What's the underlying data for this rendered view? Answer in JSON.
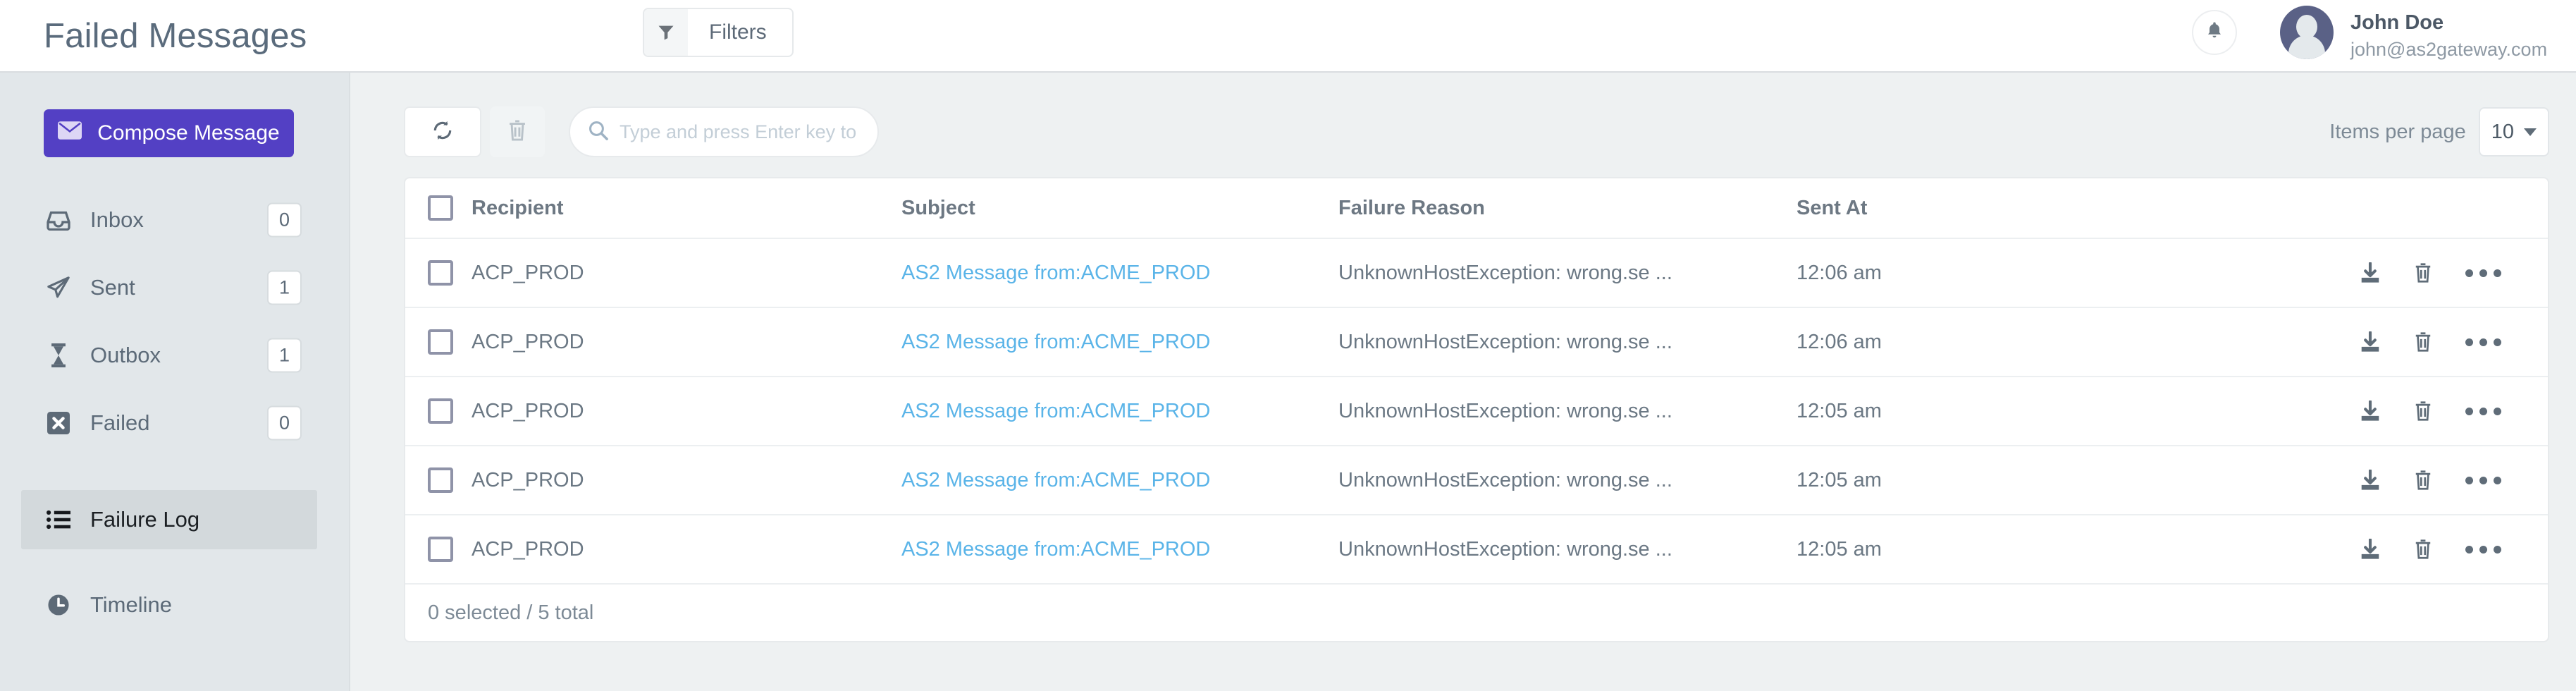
{
  "header": {
    "title": "Failed Messages",
    "filters_label": "Filters",
    "filter_icon": "funnel-icon",
    "bell_icon": "bell-icon",
    "user": {
      "name": "John Doe",
      "email": "john@as2gateway.com"
    }
  },
  "sidebar": {
    "compose_label": "Compose Message",
    "compose_icon": "envelope-icon",
    "items": [
      {
        "label": "Inbox",
        "icon": "inbox-icon",
        "badge": "0",
        "active": false
      },
      {
        "label": "Sent",
        "icon": "paper-plane-icon",
        "badge": "1",
        "active": false
      },
      {
        "label": "Outbox",
        "icon": "hourglass-icon",
        "badge": "1",
        "active": false
      },
      {
        "label": "Failed",
        "icon": "x-square-icon",
        "badge": "0",
        "active": false
      },
      {
        "label": "Failure Log",
        "icon": "list-icon",
        "badge": "",
        "active": true
      },
      {
        "label": "Timeline",
        "icon": "clock-icon",
        "badge": "",
        "active": false
      }
    ]
  },
  "toolbar": {
    "refresh_icon": "refresh-icon",
    "delete_icon": "trash-icon",
    "search_placeholder": "Type and press Enter key to search",
    "search_value": "",
    "search_icon": "search-icon",
    "items_per_page_label": "Items per page",
    "items_per_page_value": "10"
  },
  "table": {
    "columns": [
      "Recipient",
      "Subject",
      "Failure Reason",
      "Sent At"
    ],
    "rows": [
      {
        "recipient": "ACP_PROD",
        "subject": "AS2 Message from:ACME_PROD",
        "reason": "UnknownHostException: wrong.se ...",
        "sent_at": "12:06 am"
      },
      {
        "recipient": "ACP_PROD",
        "subject": "AS2 Message from:ACME_PROD",
        "reason": "UnknownHostException: wrong.se ...",
        "sent_at": "12:06 am"
      },
      {
        "recipient": "ACP_PROD",
        "subject": "AS2 Message from:ACME_PROD",
        "reason": "UnknownHostException: wrong.se ...",
        "sent_at": "12:05 am"
      },
      {
        "recipient": "ACP_PROD",
        "subject": "AS2 Message from:ACME_PROD",
        "reason": "UnknownHostException: wrong.se ...",
        "sent_at": "12:05 am"
      },
      {
        "recipient": "ACP_PROD",
        "subject": "AS2 Message from:ACME_PROD",
        "reason": "UnknownHostException: wrong.se ...",
        "sent_at": "12:05 am"
      }
    ],
    "row_actions": [
      "download-icon",
      "trash-icon",
      "more-options-icon"
    ],
    "footer_text": "0 selected / 5 total"
  },
  "colors": {
    "accent_purple": "#5340c4",
    "link_blue": "#5ab4e8",
    "sidebar_bg": "#e2e7ea",
    "content_bg": "#eef1f2",
    "avatar_bg": "#5a6186"
  }
}
